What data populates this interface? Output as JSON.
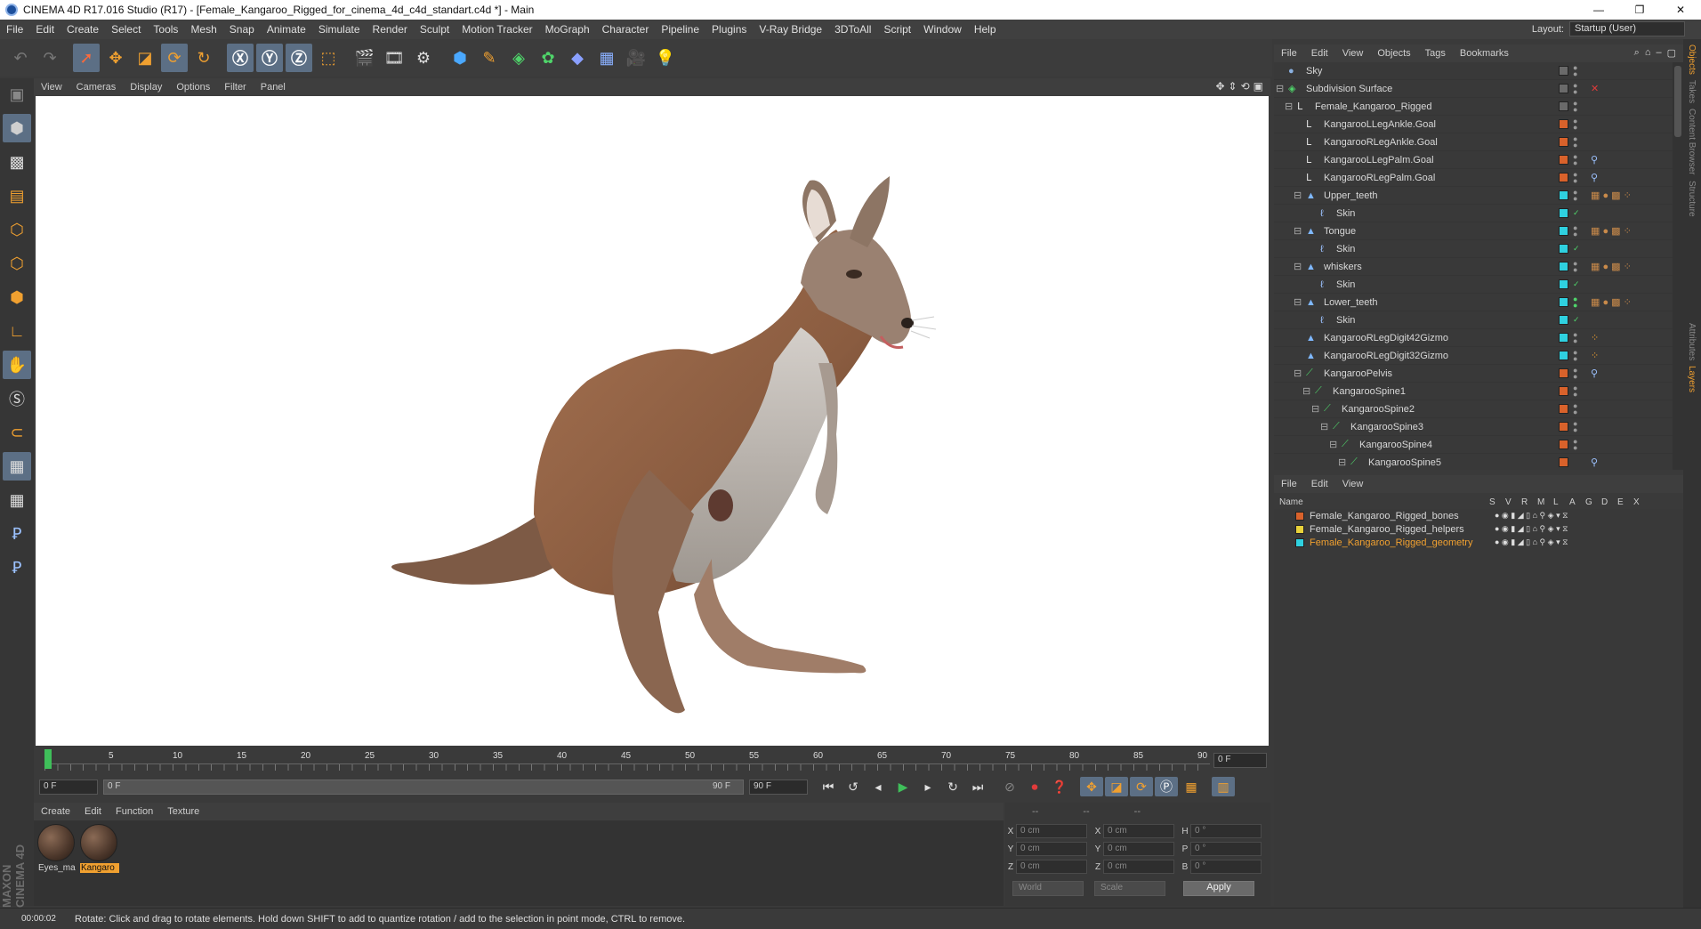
{
  "window": {
    "title": "CINEMA 4D R17.016 Studio (R17) - [Female_Kangaroo_Rigged_for_cinema_4d_c4d_standart.c4d *] - Main",
    "controls": [
      "—",
      "❐",
      "✕"
    ]
  },
  "menubar": {
    "items": [
      "File",
      "Edit",
      "Create",
      "Select",
      "Tools",
      "Mesh",
      "Snap",
      "Animate",
      "Simulate",
      "Render",
      "Sculpt",
      "Motion Tracker",
      "MoGraph",
      "Character",
      "Pipeline",
      "Plugins",
      "V-Ray Bridge",
      "3DToAll",
      "Script",
      "Window",
      "Help"
    ],
    "layout_label": "Layout:",
    "layout_value": "Startup (User)"
  },
  "viewport": {
    "menu": [
      "View",
      "Cameras",
      "Display",
      "Options",
      "Filter",
      "Panel"
    ]
  },
  "timeline": {
    "ticks": [
      "0",
      "5",
      "10",
      "15",
      "20",
      "25",
      "30",
      "35",
      "40",
      "45",
      "50",
      "55",
      "60",
      "65",
      "70",
      "75",
      "80",
      "85",
      "90"
    ],
    "current_frame": "0 F",
    "start_field": "0 F",
    "range_start": "0 F",
    "range_end": "90 F",
    "end_field": "90 F"
  },
  "material_manager": {
    "menu": [
      "Create",
      "Edit",
      "Function",
      "Texture"
    ],
    "materials": [
      {
        "label": "Eyes_ma",
        "selected": false
      },
      {
        "label": "Kangaro",
        "selected": true
      }
    ]
  },
  "coordinates": {
    "headers": [
      "--",
      "--",
      "--"
    ],
    "rows": [
      {
        "a": "X",
        "av": "0 cm",
        "b": "X",
        "bv": "0 cm",
        "c": "H",
        "cv": "0 °"
      },
      {
        "a": "Y",
        "av": "0 cm",
        "b": "Y",
        "bv": "0 cm",
        "c": "P",
        "cv": "0 °"
      },
      {
        "a": "Z",
        "av": "0 cm",
        "b": "Z",
        "bv": "0 cm",
        "c": "B",
        "cv": "0 °"
      }
    ],
    "mode1": "World",
    "mode2": "Scale",
    "apply": "Apply"
  },
  "brand": "MAXON CINEMA 4D",
  "status": {
    "time": "00:00:02",
    "message": "Rotate: Click and drag to rotate elements. Hold down SHIFT to add to quantize rotation / add to the selection in point mode, CTRL to remove."
  },
  "object_manager": {
    "menu": [
      "File",
      "Edit",
      "View",
      "Objects",
      "Tags",
      "Bookmarks"
    ],
    "objects": [
      {
        "name": "Sky",
        "color": "#6a6a6a"
      },
      {
        "name": "Subdivision Surface",
        "color": "#6a6a6a"
      },
      {
        "name": "Female_Kangaroo_Rigged",
        "color": "#6a6a6a"
      },
      {
        "name": "KangarooLLegAnkle.Goal",
        "color": "#d9622b"
      },
      {
        "name": "KangarooRLegAnkle.Goal",
        "color": "#d9622b"
      },
      {
        "name": "KangarooLLegPalm.Goal",
        "color": "#d9622b"
      },
      {
        "name": "KangarooRLegPalm.Goal",
        "color": "#d9622b"
      },
      {
        "name": "Upper_teeth",
        "color": "#2fd1e0"
      },
      {
        "name": "Skin",
        "color": "#2fd1e0"
      },
      {
        "name": "Tongue",
        "color": "#2fd1e0"
      },
      {
        "name": "Skin",
        "color": "#2fd1e0"
      },
      {
        "name": "whiskers",
        "color": "#2fd1e0"
      },
      {
        "name": "Skin",
        "color": "#2fd1e0"
      },
      {
        "name": "Lower_teeth",
        "color": "#2fd1e0"
      },
      {
        "name": "Skin",
        "color": "#2fd1e0"
      },
      {
        "name": "KangarooRLegDigit42Gizmo",
        "color": "#2fd1e0"
      },
      {
        "name": "KangarooRLegDigit32Gizmo",
        "color": "#2fd1e0"
      },
      {
        "name": "KangarooPelvis",
        "color": "#d9622b"
      },
      {
        "name": "KangarooSpine1",
        "color": "#d9622b"
      },
      {
        "name": "KangarooSpine2",
        "color": "#d9622b"
      },
      {
        "name": "KangarooSpine3",
        "color": "#d9622b"
      },
      {
        "name": "KangarooSpine4",
        "color": "#d9622b"
      },
      {
        "name": "KangarooSpine5",
        "color": "#d9622b"
      }
    ]
  },
  "layer_manager": {
    "menu": [
      "File",
      "Edit",
      "View"
    ],
    "columns": [
      "Name",
      "S",
      "V",
      "R",
      "M",
      "L",
      "A",
      "G",
      "D",
      "E",
      "X"
    ],
    "layers": [
      {
        "name": "Female_Kangaroo_Rigged_bones",
        "color": "#d9622b",
        "active": false
      },
      {
        "name": "Female_Kangaroo_Rigged_helpers",
        "color": "#e8d23a",
        "active": false
      },
      {
        "name": "Female_Kangaroo_Rigged_geometry",
        "color": "#2fd1e0",
        "active": true
      }
    ]
  },
  "right_tabs": [
    "Objects",
    "Takes",
    "Content Browser",
    "Structure",
    "Attributes",
    "Layers"
  ]
}
